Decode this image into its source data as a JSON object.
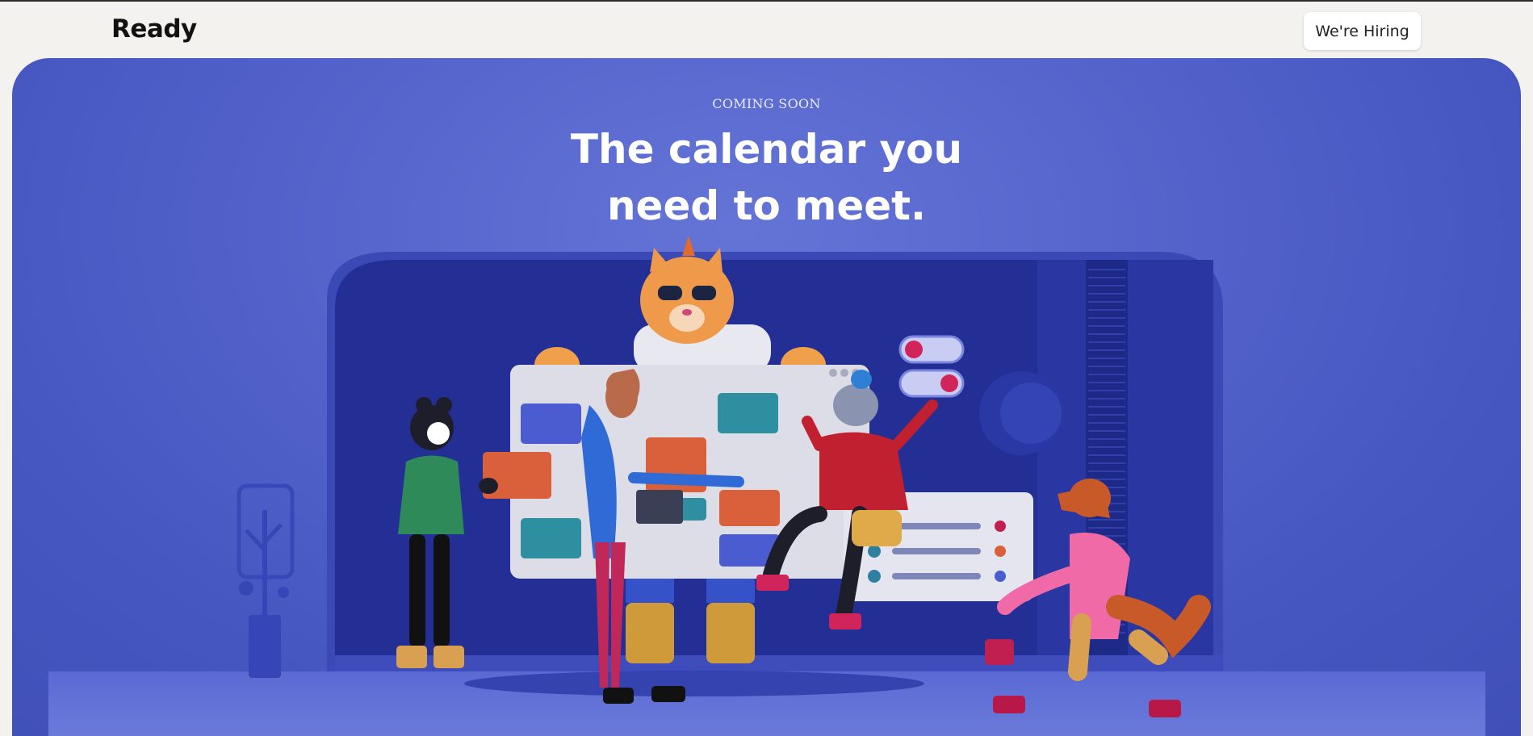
{
  "header": {
    "logo": "Ready",
    "hiring_button": "We're Hiring"
  },
  "hero": {
    "eyebrow": "COMING SOON",
    "headline_line1": "The calendar you",
    "headline_line2": "need to meet."
  },
  "colors": {
    "page_bg": "#f4f2ee",
    "hero_blue": "#5565cc",
    "stage_navy": "#232f94",
    "tile_blue": "#4b5bd0",
    "tile_teal": "#2e8fa0",
    "tile_orange": "#d9603a",
    "toggle_pink": "#d0245a"
  },
  "icons": {
    "check": "check-circle-icon",
    "toggle": "toggle-switch-icon"
  }
}
